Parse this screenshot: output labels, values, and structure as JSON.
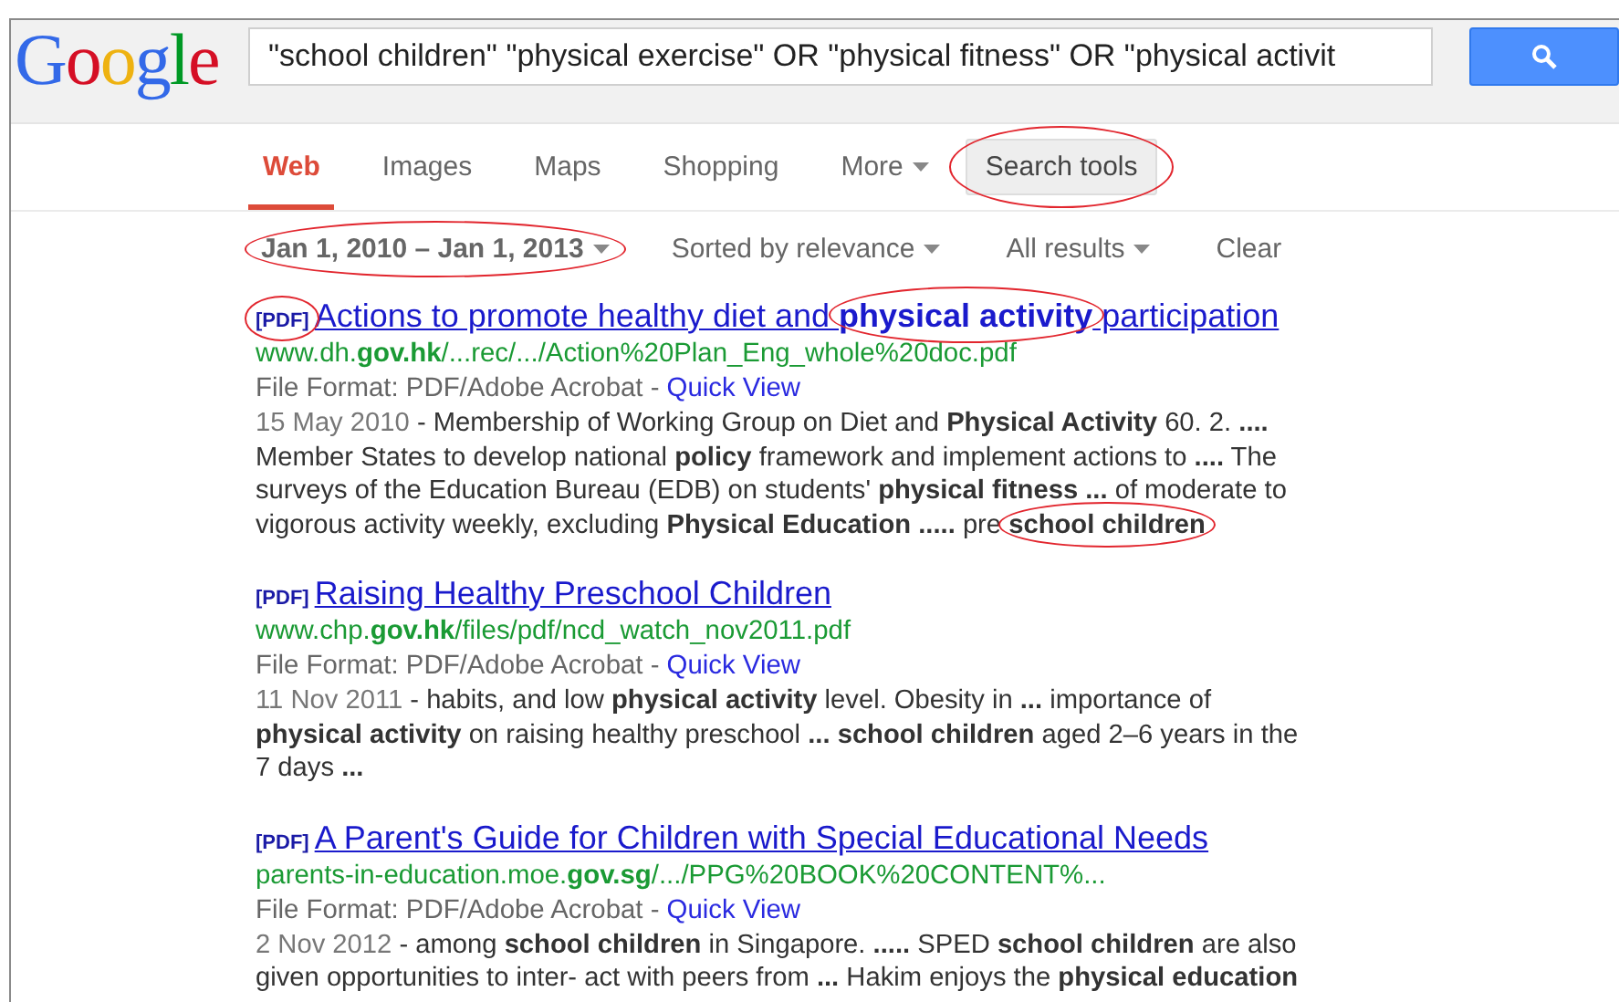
{
  "logo": "Google",
  "search": {
    "value": "\"school children\" \"physical exercise\" OR \"physical fitness\" OR \"physical activit"
  },
  "tabs": [
    {
      "label": "Web",
      "selected": true,
      "kind": "tab",
      "circled": false
    },
    {
      "label": "Images",
      "selected": false,
      "kind": "tab",
      "circled": false
    },
    {
      "label": "Maps",
      "selected": false,
      "kind": "tab",
      "circled": false
    },
    {
      "label": "Shopping",
      "selected": false,
      "kind": "tab",
      "circled": false
    },
    {
      "label": "More",
      "selected": false,
      "kind": "menu",
      "circled": false
    },
    {
      "label": "Search tools",
      "selected": false,
      "kind": "button",
      "circled": true
    }
  ],
  "filters": [
    {
      "label": "Jan 1, 2010 – Jan 1, 2013",
      "kind": "date",
      "circled": true
    },
    {
      "label": "Sorted by relevance",
      "kind": "menu",
      "circled": false
    },
    {
      "label": "All results",
      "kind": "menu",
      "circled": false
    },
    {
      "label": "Clear",
      "kind": "link",
      "circled": false
    }
  ],
  "results": [
    {
      "tag": "[PDF]",
      "tag_circled": true,
      "title": "Actions to promote healthy diet and ",
      "title_circled": "physical activity",
      "title_end": " participation",
      "url": "www.dh.**gov.hk**/...rec/.../Action%20Plan_Eng_whole%20doc.pdf",
      "file_format": "File Format: PDF/Adobe Acrobat -",
      "quick_view": "Quick View",
      "date": "15 May 2010",
      "snippet": " - Membership of Working Group on Diet and **Physical Activity** 60. 2. **....** Member States to develop national **policy** framework and implement actions to **....** The surveys of the Education Bureau (EDB) on students' **physical fitness ...** of moderate to vigorous activity weekly, excluding **Physical Education .....** pre",
      "snippet_circled": "school children"
    },
    {
      "tag": "[PDF]",
      "tag_circled": false,
      "title": "Raising Healthy Preschool Children",
      "url": "www.chp.**gov.hk**/files/pdf/ncd_watch_nov2011.pdf",
      "file_format": "File Format: PDF/Adobe Acrobat -",
      "quick_view": "Quick View",
      "date": "11 Nov 2011",
      "snippet": " - habits, and low **physical activity** level. Obesity in **...** importance of **physical activity** on raising healthy preschool **... school children** aged 2–6 years in the 7 days **...**"
    },
    {
      "tag": "[PDF]",
      "tag_circled": false,
      "title": "A Parent's Guide for Children with Special Educational Needs",
      "url": "parents-in-education.moe.**gov.sg**/.../PPG%20BOOK%20CONTENT%...",
      "file_format": "File Format: PDF/Adobe Acrobat -",
      "quick_view": "Quick View",
      "date": "2 Nov 2012",
      "snippet": " - among **school children** in Singapore. **.....** SPED **school children** are also given opportunities to inter- act with peers from **...** Hakim enjoys the **physical education**"
    }
  ]
}
